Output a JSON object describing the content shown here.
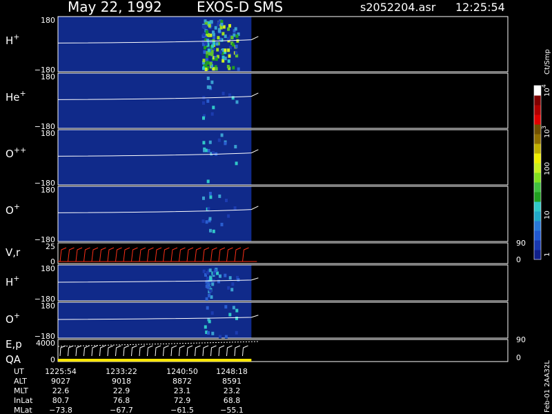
{
  "header": {
    "date": "May 22, 1992",
    "mission": "EXOS-D SMS",
    "file": "s2052204.asr",
    "time": "12:25:54"
  },
  "colors": {
    "background": "#000000",
    "panel_fill": "#102a8a",
    "frame": "#ffffff",
    "trace": "#ffffff",
    "vr_trace": "#ff3018",
    "qa_bar": "#ffe800"
  },
  "colorbar": {
    "label": "Ct/Smp",
    "labels": [
      "1",
      "10",
      "100",
      "10",
      "10"
    ],
    "exponents": [
      "",
      "",
      "",
      "3",
      "4"
    ],
    "colors": [
      "#10208a",
      "#1838b0",
      "#2058d0",
      "#2878d8",
      "#20a8c8",
      "#30c8c8",
      "#20a020",
      "#40c040",
      "#80e020",
      "#c8f020",
      "#f0f000",
      "#c0b000",
      "#907000",
      "#705000",
      "#e00000",
      "#b00000",
      "#800000",
      "#ffffff"
    ]
  },
  "chart_data": {
    "type": "heatmap",
    "panels": [
      {
        "id": "h-plus",
        "label": "H",
        "sup": "+",
        "ymax": "180",
        "ymin": "−180",
        "activity": 3
      },
      {
        "id": "he-plus",
        "label": "He",
        "sup": "+",
        "ymax": "180",
        "ymin": "−180",
        "activity": 1
      },
      {
        "id": "o-plus-plus",
        "label": "O",
        "sup": "++",
        "ymax": "180",
        "ymin": "−180",
        "activity": 1
      },
      {
        "id": "o-plus",
        "label": "O",
        "sup": "+",
        "ymax": "180",
        "ymin": "−180",
        "activity": 1
      },
      {
        "id": "v-r",
        "label": "V,r",
        "sup": "",
        "ymax": "25",
        "ymin": "0",
        "right_top": "90",
        "right_bottom": "0"
      },
      {
        "id": "h-plus-2",
        "label": "H",
        "sup": "+",
        "ymax": "180",
        "ymin": "−180",
        "activity": 2
      },
      {
        "id": "o-plus-2",
        "label": "O",
        "sup": "+",
        "ymax": "180",
        "ymin": "−180",
        "activity": 1
      },
      {
        "id": "e-p-qa",
        "label": "E,p",
        "sup": "",
        "label2": "QA",
        "ymax": "4000",
        "ymin": "0",
        "right_top": "90",
        "right_bottom": "0"
      }
    ],
    "ephemeris": {
      "rows": [
        {
          "name": "UT",
          "values": [
            "1225:54",
            "1233:22",
            "1240:50",
            "1248:18"
          ]
        },
        {
          "name": "ALT",
          "values": [
            "9027",
            "9018",
            "8872",
            "8591"
          ]
        },
        {
          "name": "MLT",
          "values": [
            "22.6",
            "22.9",
            "23.1",
            "23.2"
          ]
        },
        {
          "name": "InLat",
          "values": [
            "80.7",
            "76.8",
            "72.9",
            "68.8"
          ]
        },
        {
          "name": "MLat",
          "values": [
            "−73.8",
            "−67.7",
            "−61.5",
            "−55.1"
          ]
        }
      ]
    },
    "data_end_fraction": 0.43
  },
  "footer_stamp": "Feb-01 2AA32L"
}
